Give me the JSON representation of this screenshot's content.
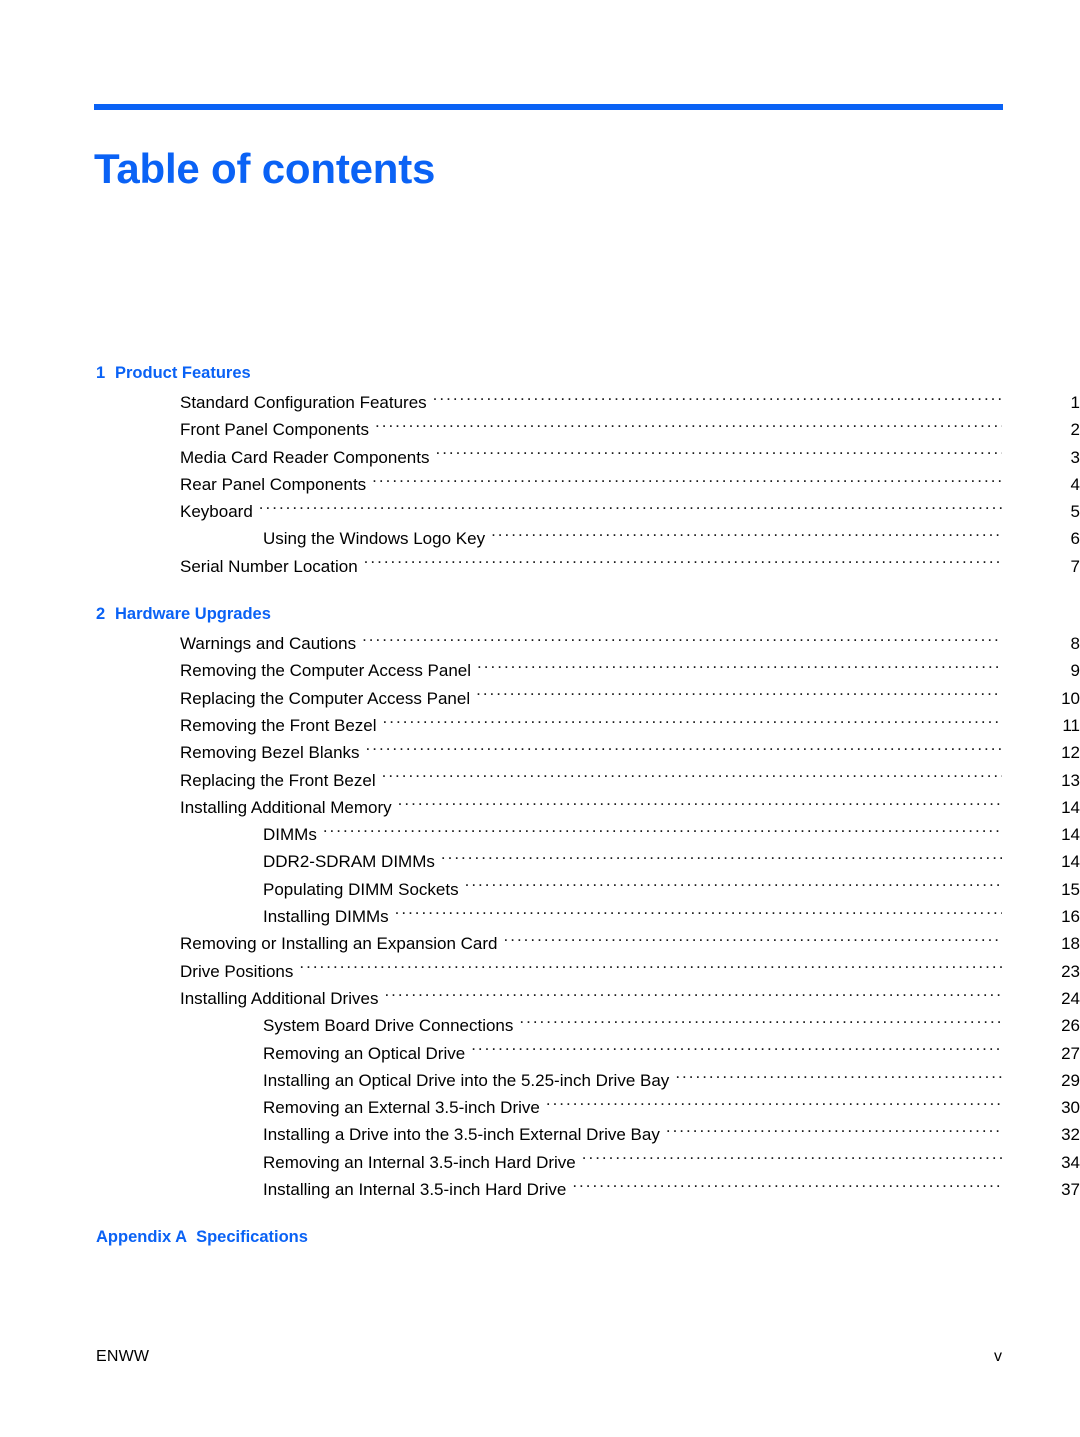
{
  "document": {
    "title": "Table of contents",
    "accent_color": "#0a62f5",
    "text_color": "#000000",
    "background_color": "#ffffff"
  },
  "sections": [
    {
      "number": "1",
      "label": "Product Features",
      "entries": [
        {
          "level": 1,
          "text": "Standard Configuration Features",
          "page": "1"
        },
        {
          "level": 1,
          "text": "Front Panel Components",
          "page": "2"
        },
        {
          "level": 1,
          "text": "Media Card Reader Components",
          "page": "3"
        },
        {
          "level": 1,
          "text": "Rear Panel Components",
          "page": "4"
        },
        {
          "level": 1,
          "text": "Keyboard",
          "page": "5"
        },
        {
          "level": 2,
          "text": "Using the Windows Logo Key",
          "page": "6"
        },
        {
          "level": 1,
          "text": "Serial Number Location",
          "page": "7"
        }
      ]
    },
    {
      "number": "2",
      "label": "Hardware Upgrades",
      "entries": [
        {
          "level": 1,
          "text": "Warnings and Cautions",
          "page": "8"
        },
        {
          "level": 1,
          "text": "Removing the Computer Access Panel",
          "page": "9"
        },
        {
          "level": 1,
          "text": "Replacing the Computer Access Panel",
          "page": "10"
        },
        {
          "level": 1,
          "text": "Removing the Front Bezel",
          "page": "11"
        },
        {
          "level": 1,
          "text": "Removing Bezel Blanks",
          "page": "12"
        },
        {
          "level": 1,
          "text": "Replacing the Front Bezel",
          "page": "13"
        },
        {
          "level": 1,
          "text": "Installing Additional Memory",
          "page": "14"
        },
        {
          "level": 2,
          "text": "DIMMs",
          "page": "14"
        },
        {
          "level": 2,
          "text": "DDR2-SDRAM DIMMs",
          "page": "14"
        },
        {
          "level": 2,
          "text": "Populating DIMM Sockets",
          "page": "15"
        },
        {
          "level": 2,
          "text": "Installing DIMMs",
          "page": "16"
        },
        {
          "level": 1,
          "text": "Removing or Installing an Expansion Card",
          "page": "18"
        },
        {
          "level": 1,
          "text": "Drive Positions",
          "page": "23"
        },
        {
          "level": 1,
          "text": "Installing Additional Drives",
          "page": "24"
        },
        {
          "level": 2,
          "text": "System Board Drive Connections",
          "page": "26"
        },
        {
          "level": 2,
          "text": "Removing an Optical Drive",
          "page": "27"
        },
        {
          "level": 2,
          "text": "Installing an Optical Drive into the 5.25-inch Drive Bay",
          "page": "29"
        },
        {
          "level": 2,
          "text": "Removing an External 3.5-inch Drive",
          "page": "30"
        },
        {
          "level": 2,
          "text": "Installing a Drive into the 3.5-inch External Drive Bay",
          "page": "32"
        },
        {
          "level": 2,
          "text": "Removing an Internal 3.5-inch Hard Drive",
          "page": "34"
        },
        {
          "level": 2,
          "text": "Installing an Internal 3.5-inch Hard Drive",
          "page": "37"
        }
      ]
    },
    {
      "number": "Appendix A",
      "label": "Specifications",
      "appendix": true,
      "entries": []
    }
  ],
  "footer": {
    "left": "ENWW",
    "right": "v"
  }
}
